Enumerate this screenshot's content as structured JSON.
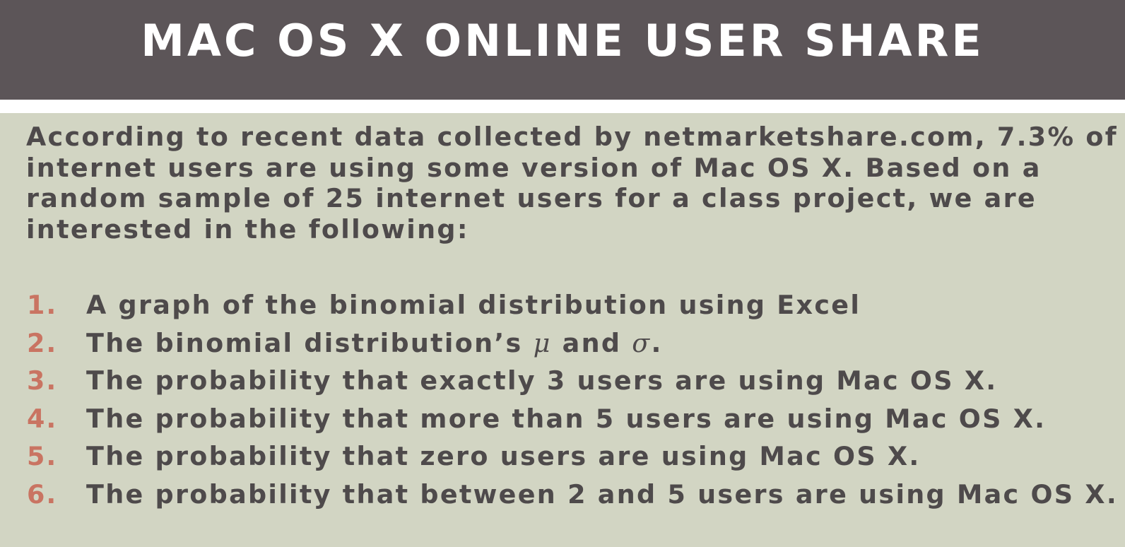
{
  "slide": {
    "title": "MAC OS X ONLINE USER SHARE",
    "intro": "According to recent data collected by netmarketshare.com, 7.3% of internet users are using some version of Mac OS X. Based on a random sample of 25 internet users for a class project, we are interested in the following:",
    "items": [
      {
        "number": "1.",
        "text": "A graph of the binomial distribution using Excel"
      },
      {
        "number": "2.",
        "text_before": "The binomial distribution’s ",
        "mu": "μ",
        "text_middle": " and ",
        "sigma": "σ",
        "text_after": "."
      },
      {
        "number": "3.",
        "text": "The probability that exactly 3 users are using Mac OS X."
      },
      {
        "number": "4.",
        "text": "The probability that more than 5 users are using Mac OS X."
      },
      {
        "number": "5.",
        "text": "The probability that zero users are using Mac OS X."
      },
      {
        "number": "6.",
        "text": "The probability that between 2 and 5 users are using Mac OS X."
      }
    ]
  },
  "colors": {
    "title_bar": "#5c5558",
    "title_text": "#ffffff",
    "body_background": "#d2d5c3",
    "body_text": "#4e4a4b",
    "list_number": "#c97462"
  }
}
